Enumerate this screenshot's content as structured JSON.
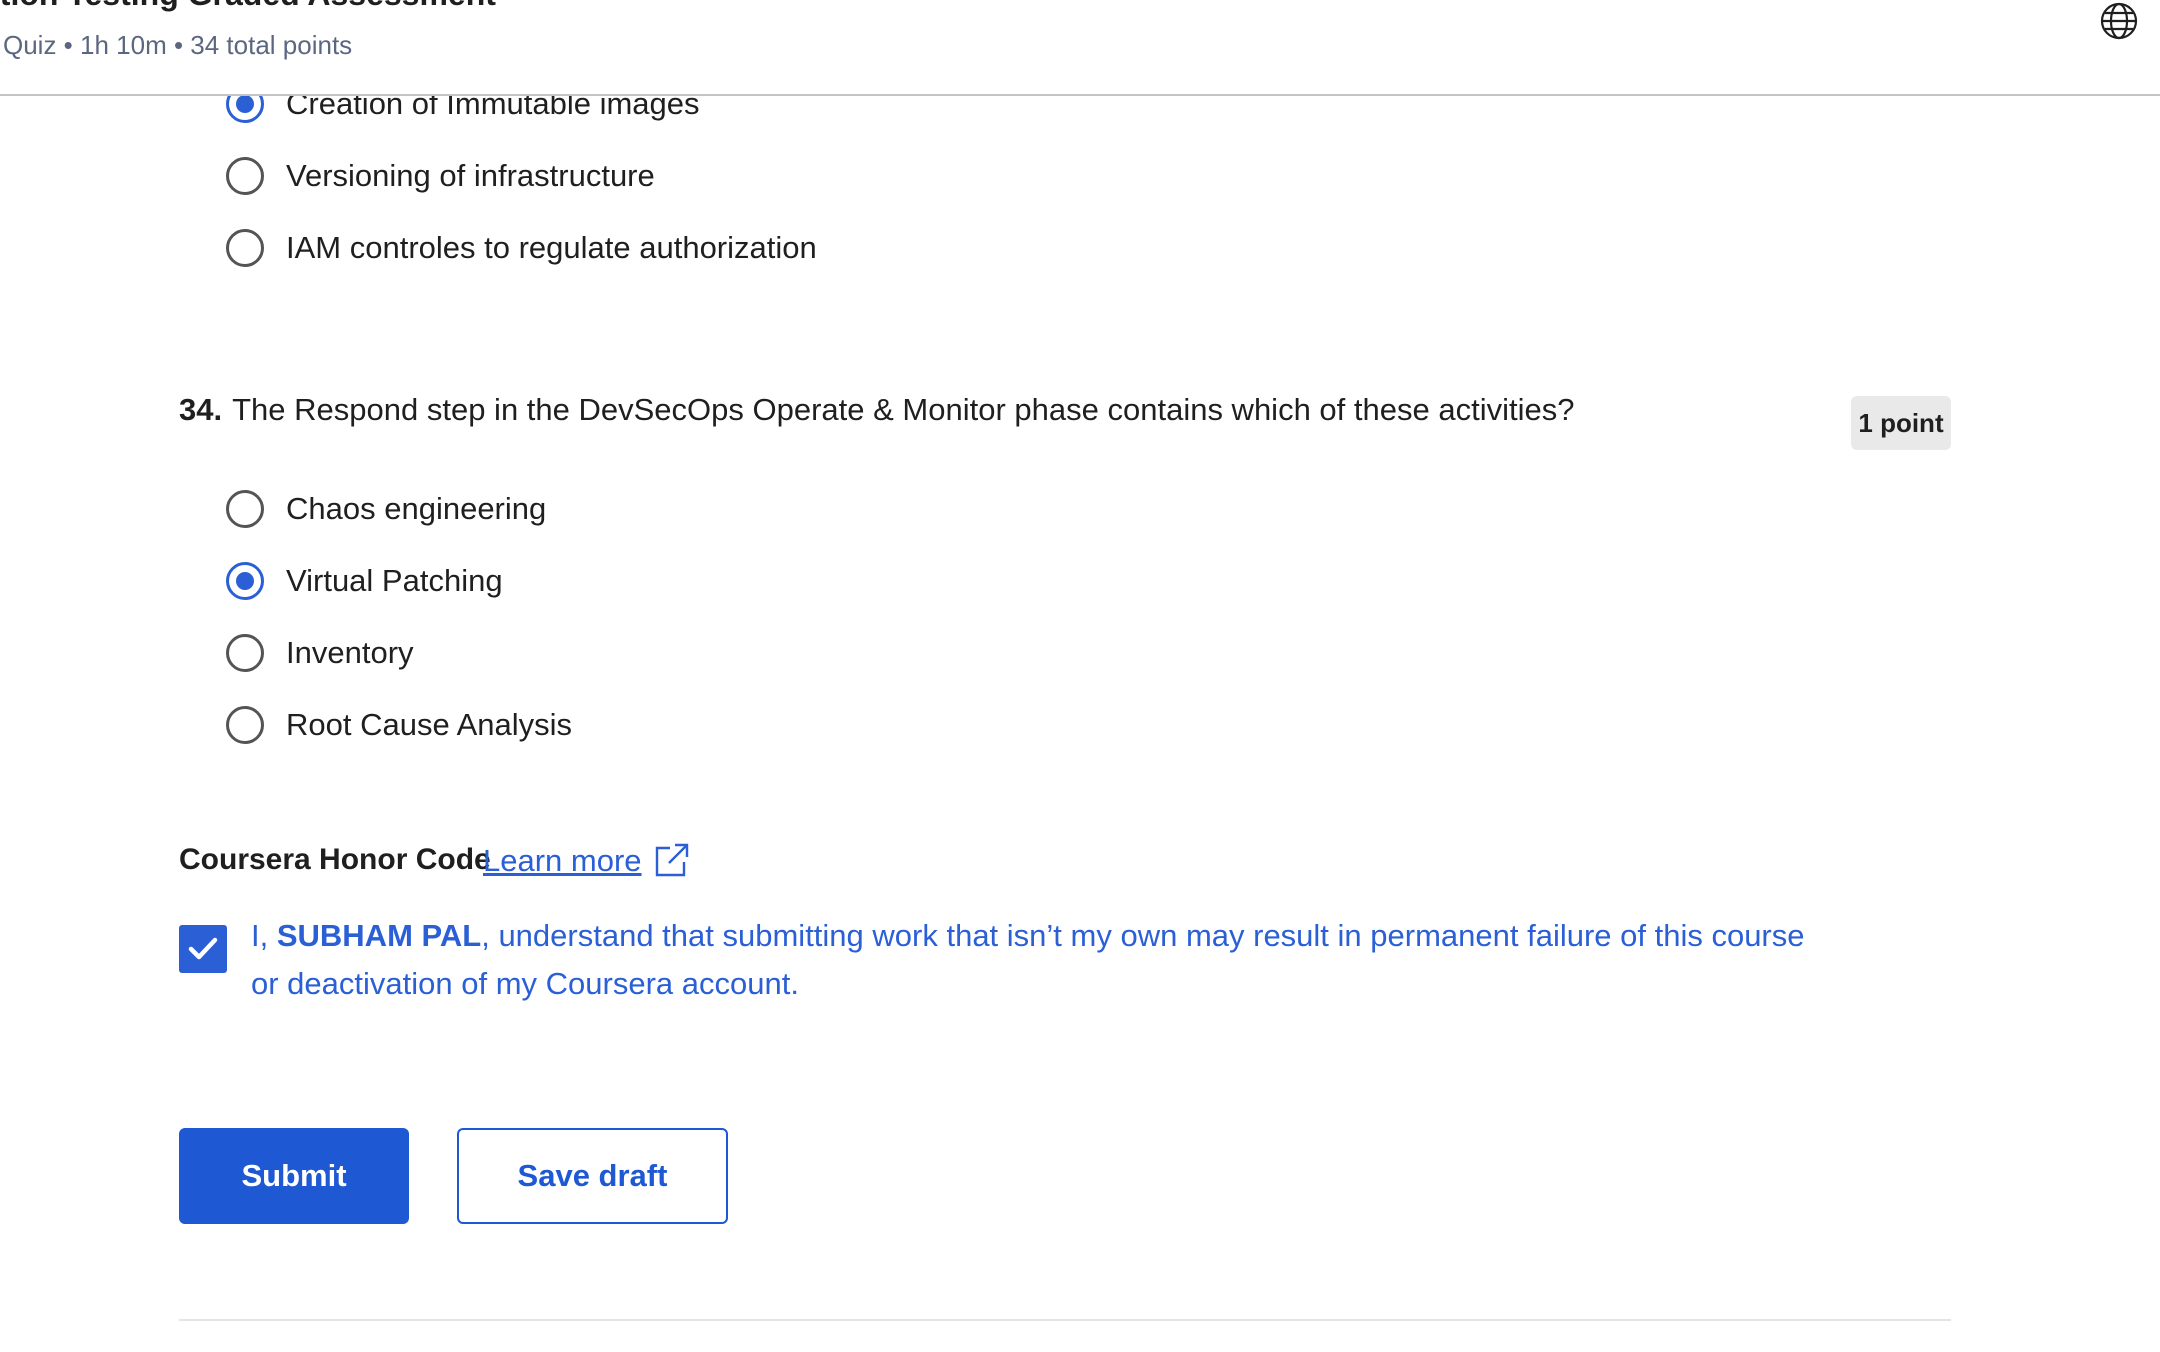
{
  "header": {
    "title": "ation Testing Graded Assessment",
    "meta": "Quiz • 1h 10m • 34 total points",
    "language_icon": "globe-icon"
  },
  "prev_question": {
    "options": [
      {
        "label": "Creation of Immutable images",
        "selected": true
      },
      {
        "label": "Versioning of infrastructure",
        "selected": false
      },
      {
        "label": "IAM controles to regulate authorization",
        "selected": false
      }
    ]
  },
  "question": {
    "number": "34.",
    "text": "The Respond step in the DevSecOps Operate & Monitor phase contains which of these activities?",
    "points": "1 point",
    "options": [
      {
        "label": "Chaos engineering",
        "selected": false
      },
      {
        "label": "Virtual Patching",
        "selected": true
      },
      {
        "label": "Inventory",
        "selected": false
      },
      {
        "label": "Root Cause Analysis",
        "selected": false
      }
    ]
  },
  "honor_code": {
    "title": "Coursera Honor Code",
    "learn_more": "Learn more",
    "checked": true,
    "prefix": "I, ",
    "name": "SUBHAM PAL",
    "suffix": ", understand that submitting work that isn’t my own may result in permanent failure of this course or deactivation of my Coursera account."
  },
  "actions": {
    "submit": "Submit",
    "save_draft": "Save draft"
  },
  "colors": {
    "accent": "#2a5fd6",
    "button_primary": "#1f58d3"
  }
}
